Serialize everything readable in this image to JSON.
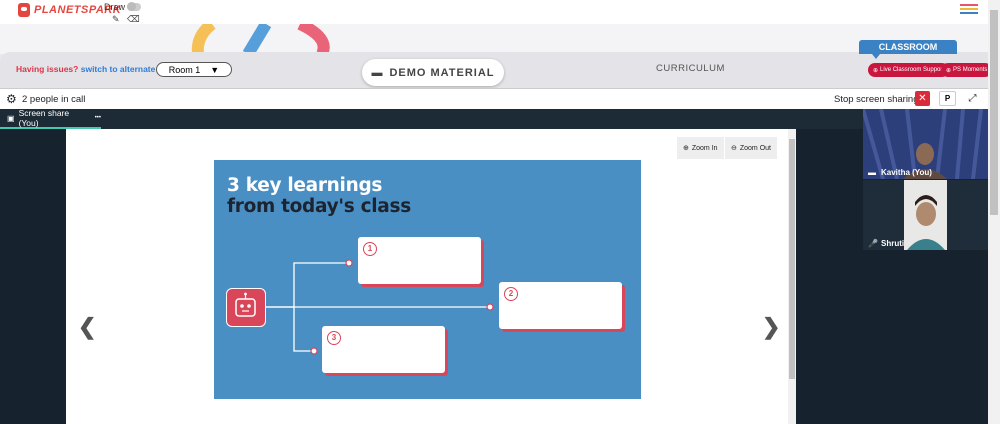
{
  "app": {
    "brand": "PLANETSPARK",
    "draw_label": "Draw"
  },
  "room_bar": {
    "issue_prefix": "Having issues?",
    "issue_link": "switch to alternate room",
    "room_selected": "Room 1",
    "demo_material": "DEMO MATERIAL",
    "curriculum": "CURRICULUM",
    "classroom": "CLASSROOM",
    "live_support": "Live Classroom Support",
    "ps_moments": "PS Moments"
  },
  "call_bar": {
    "people": "2 people in call",
    "stop_sharing": "Stop screen sharing",
    "p_label": "P"
  },
  "stage": {
    "tab_label": "Screen share (You)",
    "tab_more": "•••",
    "zoom_in": "Zoom In",
    "zoom_out": "Zoom Out"
  },
  "slide": {
    "title_line1": "3 key learnings",
    "title_line2": "from today's class",
    "items": [
      "1",
      "2",
      "3"
    ]
  },
  "participants": [
    {
      "name": "Kavitha (You)"
    },
    {
      "name": "Shruti"
    }
  ],
  "colors": {
    "accent_red": "#d9465a",
    "slide_blue": "#4a8fc4",
    "classroom_blue": "#3b82c4",
    "pill_red": "#c9163f"
  }
}
